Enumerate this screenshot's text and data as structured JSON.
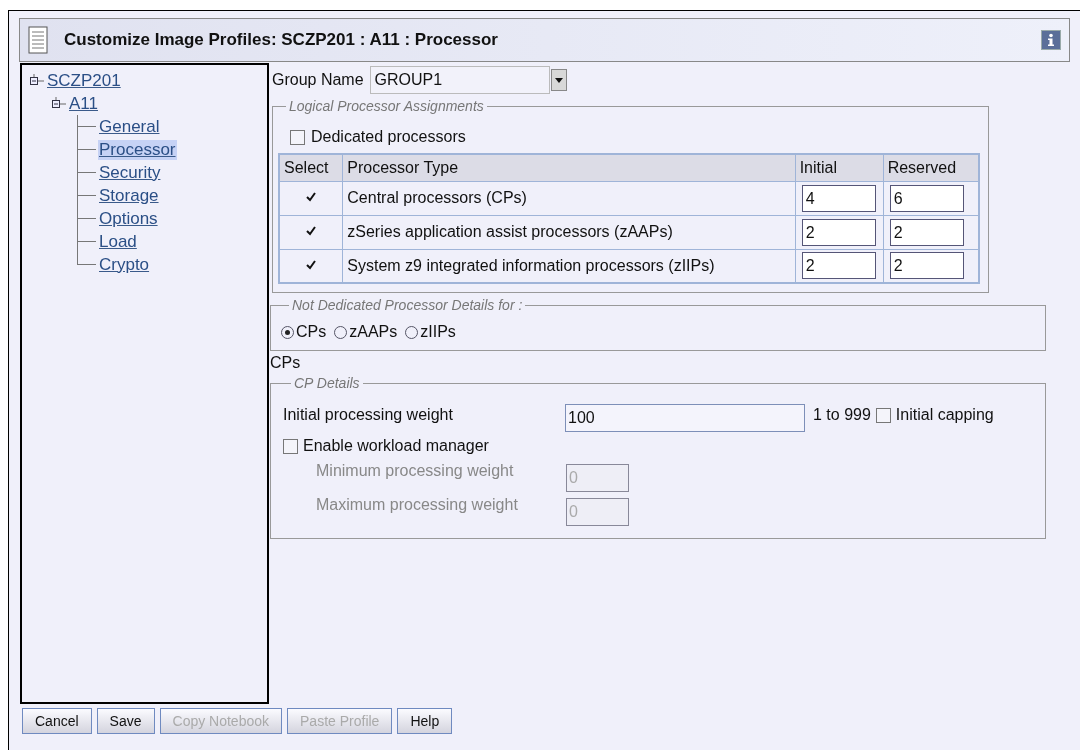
{
  "window": {
    "title": "Customize Image Profiles: SCZP201 : A11 : Processor"
  },
  "tree": [
    {
      "label": "SCZP201",
      "expanded": true,
      "children": [
        {
          "label": "A11",
          "expanded": true,
          "children": [
            {
              "label": "General",
              "selected": false
            },
            {
              "label": "Processor",
              "selected": true
            },
            {
              "label": "Security",
              "selected": false
            },
            {
              "label": "Storage",
              "selected": false
            },
            {
              "label": "Options",
              "selected": false
            },
            {
              "label": "Load",
              "selected": false
            },
            {
              "label": "Crypto",
              "selected": false
            }
          ]
        }
      ]
    }
  ],
  "group_name": {
    "label": "Group Name",
    "value": "GROUP1"
  },
  "logical_assignments": {
    "legend": "Logical Processor Assignments",
    "dedicated": {
      "label": "Dedicated processors",
      "checked": false
    },
    "table": {
      "columns": [
        "Select",
        "Processor Type",
        "Initial",
        "Reserved"
      ],
      "rows": [
        {
          "checked": true,
          "type": "Central processors (CPs)",
          "initial": "4",
          "reserved": "6"
        },
        {
          "checked": true,
          "type": "zSeries application assist processors (zAAPs)",
          "initial": "2",
          "reserved": "2"
        },
        {
          "checked": true,
          "type": "System z9 integrated information processors (zIIPs)",
          "initial": "2",
          "reserved": "2"
        }
      ]
    }
  },
  "not_dedicated": {
    "legend": "Not Dedicated Processor Details for :",
    "options": [
      {
        "label": "CPs",
        "selected": true
      },
      {
        "label": "zAAPs",
        "selected": false
      },
      {
        "label": "zIIPs",
        "selected": false
      }
    ]
  },
  "section_label": "CPs",
  "cp_details": {
    "legend": "CP Details",
    "initial_weight": {
      "label": "Initial processing weight",
      "value": "100",
      "range": "1 to 999"
    },
    "initial_capping": {
      "label": "Initial capping",
      "checked": false
    },
    "workload_manager": {
      "label": "Enable workload manager",
      "checked": false
    },
    "min_weight": {
      "label": "Minimum processing weight",
      "value": "0",
      "disabled": true
    },
    "max_weight": {
      "label": "Maximum processing weight",
      "value": "0",
      "disabled": true
    }
  },
  "buttons": [
    {
      "label": "Cancel",
      "disabled": false
    },
    {
      "label": "Save",
      "disabled": false
    },
    {
      "label": "Copy Notebook",
      "disabled": true
    },
    {
      "label": "Paste Profile",
      "disabled": true
    },
    {
      "label": "Help",
      "disabled": false
    }
  ]
}
